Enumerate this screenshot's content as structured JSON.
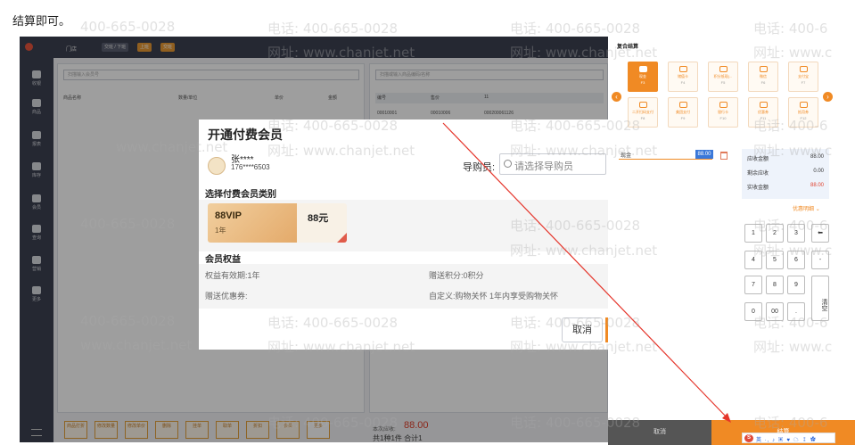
{
  "caption": "结算即可。",
  "pos": {
    "top_bar": {
      "store": "门店",
      "chips": [
        "交班 / 下班",
        "上班",
        "交班"
      ]
    },
    "sidebar": [
      {
        "label": "收银"
      },
      {
        "label": "商品"
      },
      {
        "label": "报表"
      },
      {
        "label": "库存"
      },
      {
        "label": "会员"
      },
      {
        "label": "查询"
      },
      {
        "label": "营销"
      },
      {
        "label": "更多"
      }
    ],
    "cart": {
      "search_placeholder": "扫描输入会员号",
      "headers": [
        "商品名称",
        "数量/单位",
        "单价",
        "金额"
      ]
    },
    "products": {
      "search_placeholder": "扫描或输入商品编码/名称",
      "headers": [
        "编号",
        "售价",
        "11"
      ],
      "codes": [
        "00010001",
        "00010006",
        "000200061126"
      ]
    },
    "bottom_buttons": [
      "商品打折",
      "修改数量",
      "修改单价",
      "删除",
      "挂单",
      "取单",
      "折扣",
      "会员",
      "更多"
    ],
    "total_label": "本次应收:",
    "total_value": "88.00",
    "total_summary": "共1种1件 合计1"
  },
  "dialog": {
    "title": "开通付费会员",
    "member_name": "张****",
    "member_phone": "176****6503",
    "guide_label": "导购员:",
    "guide_placeholder": "请选择导购员",
    "category_title": "选择付费会员类别",
    "card": {
      "name": "88VIP",
      "duration": "1年",
      "price": "88元"
    },
    "rights_title": "会员权益",
    "rights": {
      "validity": "权益有效期:1年",
      "points": "赠送积分:0积分",
      "coupons": "赠送优惠券:",
      "custom": "自定义:购物关怀 1年内享受购物关怀"
    },
    "cancel_label": "取消"
  },
  "checkout": {
    "title": "复合结算",
    "pay_methods": [
      {
        "name": "现金",
        "key": "F3",
        "selected": true
      },
      {
        "name": "储值卡",
        "key": "F4",
        "selected": false
      },
      {
        "name": "积分抵现(...",
        "key": "F5",
        "selected": false
      },
      {
        "name": "微信",
        "key": "F6",
        "selected": false
      },
      {
        "name": "支付宝",
        "key": "F7",
        "selected": false
      },
      {
        "name": "二开扫码支付",
        "key": "F8",
        "selected": false
      },
      {
        "name": "美团支付",
        "key": "F9",
        "selected": false
      },
      {
        "name": "银行卡",
        "key": "F10",
        "selected": false
      },
      {
        "name": "优惠券",
        "key": "F11",
        "selected": false
      },
      {
        "name": "抵用券",
        "key": "F12",
        "selected": false
      }
    ],
    "pay_line": {
      "label": "现金",
      "value": "88.00"
    },
    "summary": [
      {
        "label": "应收金额",
        "value": "88.00",
        "accent": false
      },
      {
        "label": "剩余应收",
        "value": "0.00",
        "accent": false
      },
      {
        "label": "实收金额",
        "value": "88.00",
        "accent": true
      }
    ],
    "discount_link": "优惠明细",
    "keypad": [
      "1",
      "2",
      "3",
      "⬅",
      "4",
      "5",
      "6",
      "-",
      "7",
      "8",
      "9",
      "清空",
      "0",
      "00",
      "."
    ],
    "cancel_label": "取消",
    "confirm_label": "结算",
    "ime": "英 ·, ♪ ▣ ♥ ☁ ⁑ ✿"
  },
  "watermarks": {
    "phone": "电话: 400-665-0028",
    "site": "网址: www.chanjet.net",
    "phone_cut": "电话: 400-6",
    "site_cut": "网址: www.c",
    "phone_num": "400-665-0028",
    "site_url": "www.chanjet.net"
  },
  "colors": {
    "accent": "#f08a24",
    "sidebar": "#3c4152",
    "arrow": "#e5352b"
  }
}
